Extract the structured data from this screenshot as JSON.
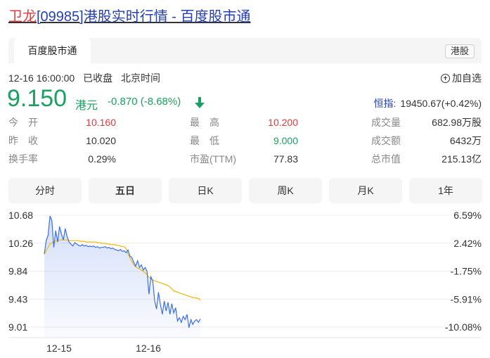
{
  "title": {
    "name": "卫龙",
    "rest": "[09985]港股实时行情 - 百度股市通"
  },
  "header": {
    "brand_tab": "百度股市通",
    "market_badge": "港股"
  },
  "status": {
    "datetime": "12-16 16:00:00",
    "state": "已收盘",
    "timezone": "北京时间"
  },
  "add_watchlist": "加自选",
  "quote": {
    "price": "9.150",
    "currency": "港元",
    "change": "-0.870",
    "change_pct": "(-8.68%)"
  },
  "index": {
    "label": "恒指:",
    "value": "19450.67(+0.42%)"
  },
  "stats": [
    {
      "label": "今　开",
      "value": "10.160"
    },
    {
      "label": "最　高",
      "value": "10.200"
    },
    {
      "label": "成交量",
      "value": "682.98万股"
    },
    {
      "label": "昨　收",
      "value": "10.020"
    },
    {
      "label": "最　低",
      "value": "9.000"
    },
    {
      "label": "成交额",
      "value": "6432万"
    },
    {
      "label": "换手率",
      "value": "0.29%"
    },
    {
      "label": "市盈(TTM)",
      "value": "77.83"
    },
    {
      "label": "总市值",
      "value": "215.13亿"
    }
  ],
  "period_tabs": [
    "分时",
    "五日",
    "日K",
    "周K",
    "月K",
    "1年"
  ],
  "active_tab": "五日",
  "colors": {
    "up": "#e4393c",
    "down": "#1aa161",
    "price_line": "#3b6ee8",
    "avg_line": "#f2b705",
    "link": "#2440b3"
  },
  "chart_data": {
    "type": "line",
    "x_labels": [
      "12-15",
      "12-16"
    ],
    "y_ticks": [
      "10.68",
      "10.26",
      "9.84",
      "9.43",
      "9.01"
    ],
    "pct_ticks": [
      "6.59%",
      "2.42%",
      "-1.75%",
      "-5.91%",
      "-10.08%"
    ],
    "ylim": [
      9.01,
      10.68
    ],
    "series": [
      {
        "name": "",
        "values": [
          10.1,
          10.3,
          10.38,
          10.67,
          10.6,
          10.2,
          10.45,
          10.28,
          10.51,
          10.4,
          10.31,
          10.48,
          10.36,
          10.28,
          10.25,
          10.22,
          10.27,
          10.25,
          10.23,
          10.22,
          10.24,
          10.22,
          10.23,
          10.21,
          10.22,
          10.21,
          10.22,
          10.2,
          10.21,
          10.19,
          10.2,
          10.2,
          10.21,
          10.19,
          10.2,
          10.18,
          10.19,
          10.17,
          10.16,
          10.15,
          10.17,
          10.14,
          10.15,
          10.12,
          10.16,
          10.07,
          10.05,
          9.98,
          9.92,
          10.0,
          9.9,
          9.94,
          9.86,
          9.9,
          9.84,
          9.5,
          9.76,
          9.7,
          9.4,
          9.28,
          9.53,
          9.35,
          9.2,
          9.4,
          9.25,
          9.38,
          9.2,
          9.36,
          9.22,
          9.3,
          9.1,
          9.15,
          9.08,
          9.17,
          9.12,
          9.2,
          9.0,
          9.12,
          9.05,
          9.1,
          9.12,
          9.08,
          9.13
        ]
      },
      {
        "name": "",
        "values": [
          10.1,
          10.15,
          10.2,
          10.25,
          10.27,
          10.28,
          10.29,
          10.3,
          10.31,
          10.31,
          10.31,
          10.31,
          10.31,
          10.3,
          10.3,
          10.3,
          10.3,
          10.3,
          10.3,
          10.29,
          10.29,
          10.29,
          10.28,
          10.28,
          10.28,
          10.28,
          10.28,
          10.28,
          10.27,
          10.27,
          10.26,
          10.26,
          10.26,
          10.25,
          10.25,
          10.24,
          10.24,
          10.24,
          10.23,
          10.23,
          10.22,
          10.21,
          10.21,
          10.18,
          10.1,
          10.04,
          9.99,
          9.94,
          9.91,
          9.89,
          9.88,
          9.86,
          9.84,
          9.82,
          9.79,
          9.75,
          9.73,
          9.71,
          9.7,
          9.69,
          9.68,
          9.67,
          9.66,
          9.65,
          9.64,
          9.63,
          9.61,
          9.58,
          9.55,
          9.54,
          9.53,
          9.52,
          9.51,
          9.5,
          9.49,
          9.48,
          9.47,
          9.46,
          9.45,
          9.45,
          9.44,
          9.44,
          9.41
        ]
      }
    ]
  }
}
